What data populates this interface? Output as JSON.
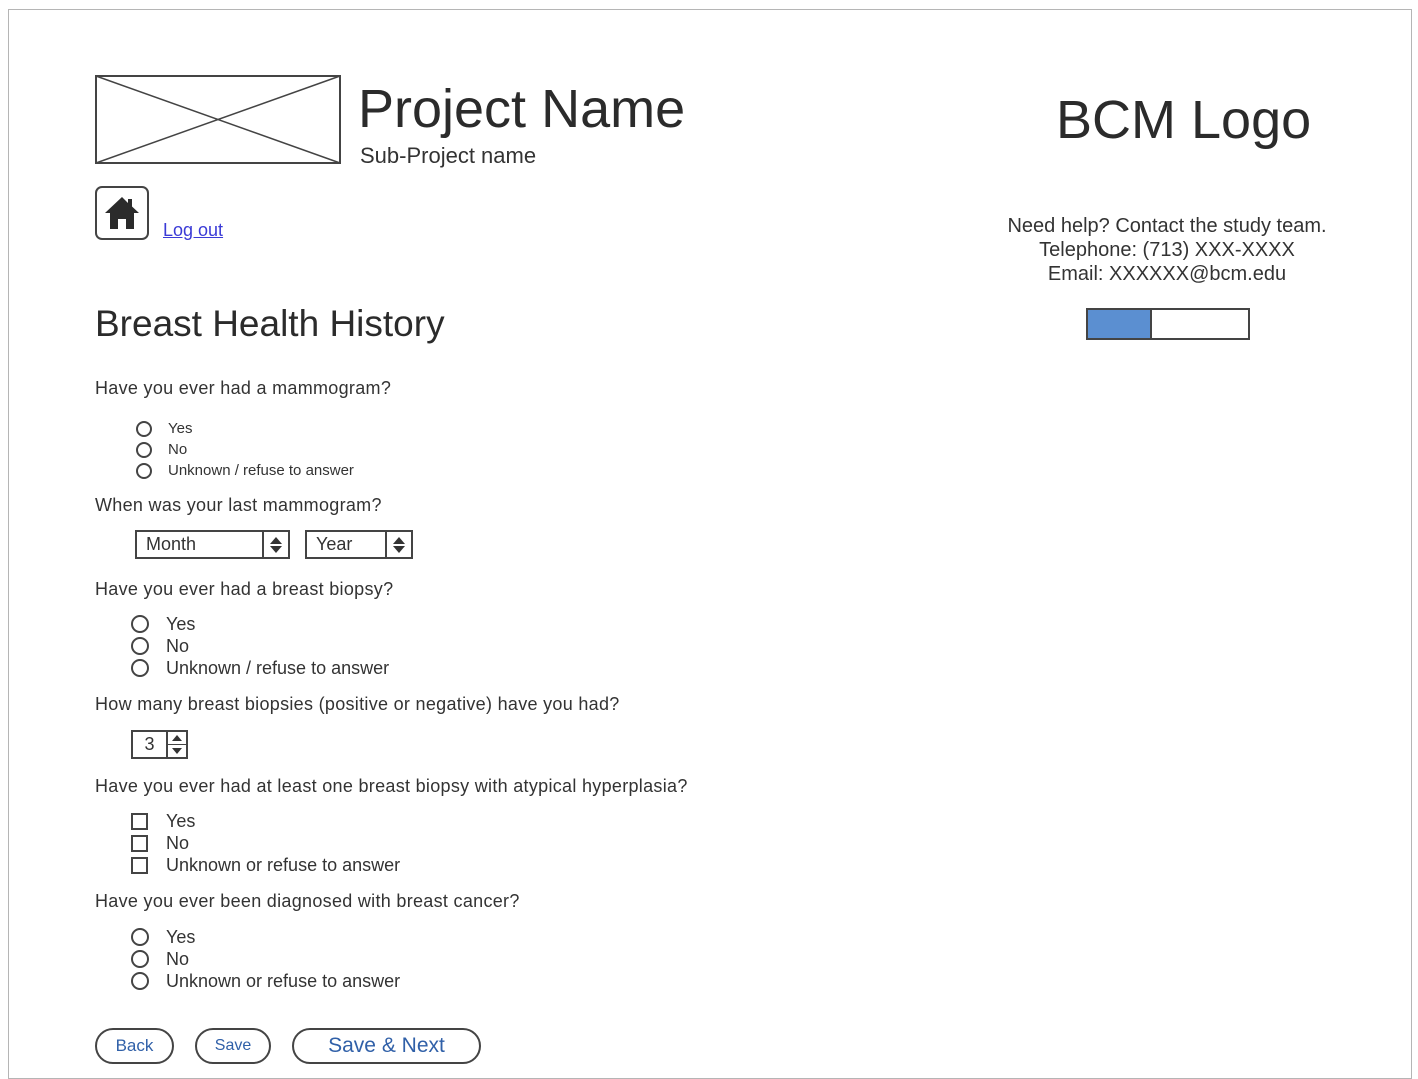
{
  "header": {
    "project_name": "Project Name",
    "sub_project_name": "Sub-Project name",
    "bcm_logo": "BCM Logo"
  },
  "nav": {
    "home_icon": "home-icon",
    "logout_label": "Log out"
  },
  "help": {
    "line1": "Need help? Contact the study team.",
    "line2": "Telephone: (713) XXX-XXXX",
    "line3": "Email: XXXXXX@bcm.edu"
  },
  "progress": {
    "fraction": 0.4,
    "fill_color": "#5b8fd1"
  },
  "page_title": "Breast Health History",
  "questions": {
    "q1": {
      "text": "Have you ever had a mammogram?",
      "options": [
        "Yes",
        "No",
        "Unknown / refuse to answer"
      ]
    },
    "q2": {
      "text": "When was your last mammogram?",
      "month_value": "Month",
      "year_value": "Year"
    },
    "q3": {
      "text": "Have you ever had a breast biopsy?",
      "options": [
        "Yes",
        "No",
        "Unknown / refuse to answer"
      ]
    },
    "q4": {
      "text": "How many breast biopsies (positive or negative) have you had?",
      "value": "3"
    },
    "q5": {
      "text": "Have you ever had at least one breast biopsy with atypical hyperplasia?",
      "options": [
        "Yes",
        "No",
        "Unknown or refuse to answer"
      ]
    },
    "q6": {
      "text": "Have you ever been diagnosed with breast cancer?",
      "options": [
        "Yes",
        "No",
        "Unknown or refuse to answer"
      ]
    }
  },
  "buttons": {
    "back": "Back",
    "save": "Save",
    "save_next": "Save & Next"
  },
  "colors": {
    "button_text": "#3060a8",
    "link": "#3a3ad6"
  }
}
